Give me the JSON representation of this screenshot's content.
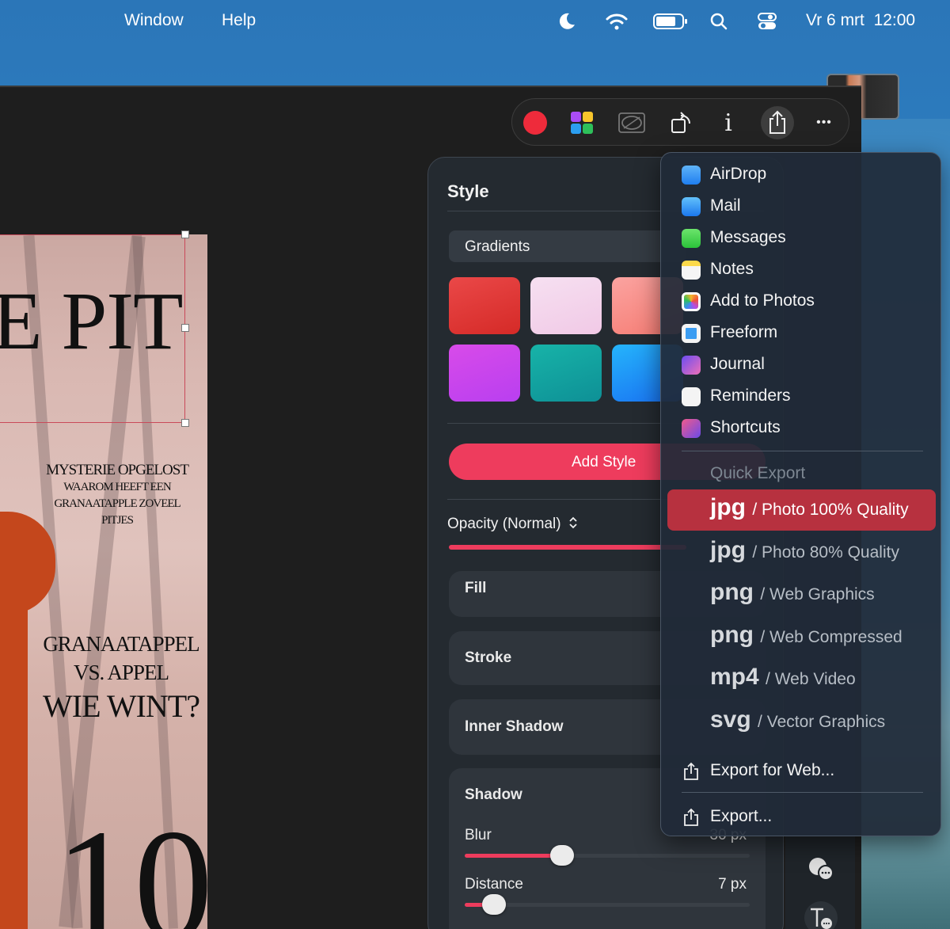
{
  "menubar": {
    "menus": [
      "Window",
      "Help"
    ],
    "date": "Vr 6 mrt",
    "time": "12:00"
  },
  "toolbar": {
    "buttons": [
      "record-dot-icon",
      "color-grid-icon",
      "mask-icon",
      "rotate-icon",
      "info-icon",
      "share-icon",
      "more-icon"
    ],
    "info_label": "i",
    "more_label": "•••",
    "colors": {
      "record": "#ee2b3b"
    }
  },
  "artboard": {
    "headline": "E PIT",
    "block1": [
      "MYSTERIE OPGELOST",
      "WAAROM HEEFT EEN",
      "GRANAATAPPLE ZOVEEL",
      "PITJES"
    ],
    "block2": [
      "GRANAATAPPEL",
      "VS. APPEL",
      "WIE WINT?"
    ],
    "big_number": "10"
  },
  "style_panel": {
    "title": "Style",
    "gradients_label": "Gradients",
    "swatches": [
      [
        "#e03536",
        "#f4d3ea",
        "#f98d86"
      ],
      [
        "#c63fe8",
        "#11a5a3",
        "#1b8cf5"
      ]
    ],
    "add_style": "Add Style",
    "opacity_label": "Opacity (Normal)",
    "sections": {
      "fill": "Fill",
      "stroke": "Stroke",
      "inner_shadow": "Inner Shadow",
      "shadow": "Shadow"
    },
    "shadow": {
      "blur_label": "Blur",
      "blur_value": "30 px",
      "distance_label": "Distance",
      "distance_value": "7 px"
    },
    "accent": "#ee3c5d"
  },
  "share_menu": {
    "items": [
      "AirDrop",
      "Mail",
      "Messages",
      "Notes",
      "Add to Photos",
      "Freeform",
      "Journal",
      "Reminders",
      "Shortcuts"
    ],
    "quick_export_header": "Quick Export",
    "exports": [
      {
        "fmt": "jpg",
        "desc": "/ Photo 100% Quality",
        "selected": true
      },
      {
        "fmt": "jpg",
        "desc": "/ Photo 80% Quality",
        "selected": false
      },
      {
        "fmt": "png",
        "desc": "/ Web Graphics",
        "selected": false
      },
      {
        "fmt": "png",
        "desc": "/ Web Compressed",
        "selected": false
      },
      {
        "fmt": "mp4",
        "desc": "/ Web Video",
        "selected": false
      },
      {
        "fmt": "svg",
        "desc": "/ Vector Graphics",
        "selected": false
      }
    ],
    "export_for_web": "Export for Web...",
    "export": "Export..."
  }
}
